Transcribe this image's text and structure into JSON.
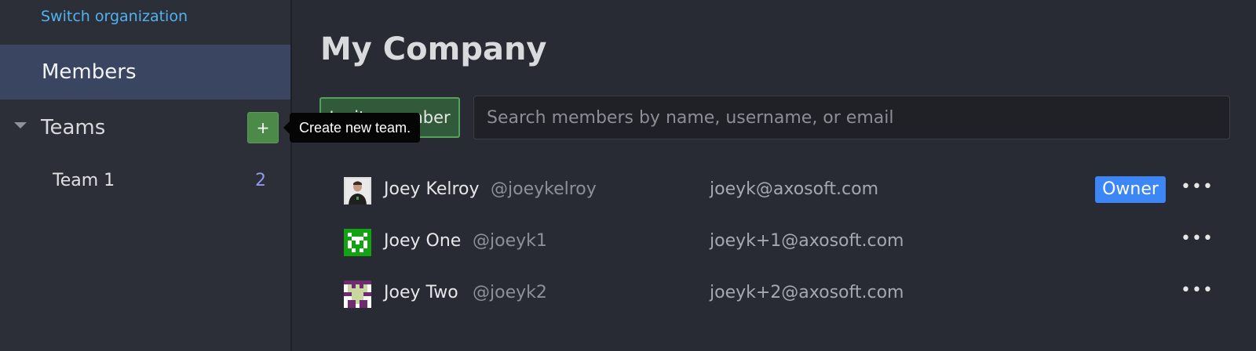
{
  "sidebar": {
    "switch_org": "Switch organization",
    "members": "Members",
    "teams_label": "Teams",
    "add_team": "+",
    "teams": [
      {
        "name": "Team 1",
        "count": "2"
      }
    ]
  },
  "tooltip": "Create new team.",
  "main": {
    "title": "My Company",
    "invite_label": "Invite member",
    "search_placeholder": "Search members by name, username, or email",
    "members": [
      {
        "name": "Joey Kelroy",
        "username": "@joeykelroy",
        "email": "joeyk@axosoft.com",
        "badge": "Owner",
        "more": "•••",
        "avatar": "photo"
      },
      {
        "name": "Joey One",
        "username": "@joeyk1",
        "email": "joeyk+1@axosoft.com",
        "more": "•••",
        "avatar": "pixel-green"
      },
      {
        "name": "Joey Two",
        "username": "@joeyk2",
        "email": "joeyk+2@axosoft.com",
        "more": "•••",
        "avatar": "pixel-purple"
      }
    ]
  },
  "colors": {
    "accent_green": "#52a35a",
    "badge_blue": "#3d86f5",
    "link_blue": "#4fb3f0",
    "selected_nav": "#3a4561"
  }
}
